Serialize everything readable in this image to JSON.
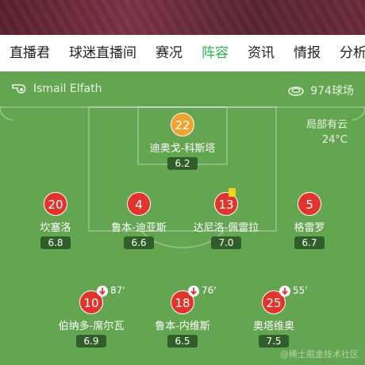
{
  "tabs": [
    "直播君",
    "球迷直播间",
    "赛况",
    "阵容",
    "资讯",
    "情报",
    "分析"
  ],
  "active_tab": "阵容",
  "referee": "Ismail Elfath",
  "stadium": "974球场",
  "weather": {
    "condition": "局部有云",
    "temp": "24°C"
  },
  "players": {
    "gk": {
      "number": "22",
      "name": "迪奥戈-科斯塔",
      "rating": "6.2"
    },
    "p1": {
      "number": "20",
      "name": "坎塞洛",
      "rating": "6.8"
    },
    "p2": {
      "number": "4",
      "name": "鲁本-迪亚斯",
      "rating": "6.6"
    },
    "p3": {
      "number": "13",
      "name": "达尼洛-佩雷拉",
      "rating": "7.0"
    },
    "p4": {
      "number": "5",
      "name": "格雷罗",
      "rating": "6.7"
    },
    "p5": {
      "number": "10",
      "name": "伯纳多-席尔瓦",
      "rating": "6.9",
      "sub_time": "87'"
    },
    "p6": {
      "number": "18",
      "name": "鲁本-内维斯",
      "rating": "6.5",
      "sub_time": "76'"
    },
    "p7": {
      "number": "25",
      "name": "奥塔维奥",
      "rating": "7.5",
      "sub_time": "55'"
    }
  },
  "watermark": "@稀土掘金技术社区",
  "colors": {
    "active_tab": "#2ab54c",
    "pitch": "#64a552",
    "player_badge": "#e0342c",
    "gk_badge": "#f0a331",
    "yellow_card": "#f4d21d",
    "sub_arrow": "#e0342c",
    "rating_bg": "#2f5e2a"
  },
  "icons": {
    "referee": "whistle-icon",
    "stadium": "stadium-icon",
    "yellow_card": "yellow-card-icon",
    "substitution": "sub-out-icon"
  }
}
